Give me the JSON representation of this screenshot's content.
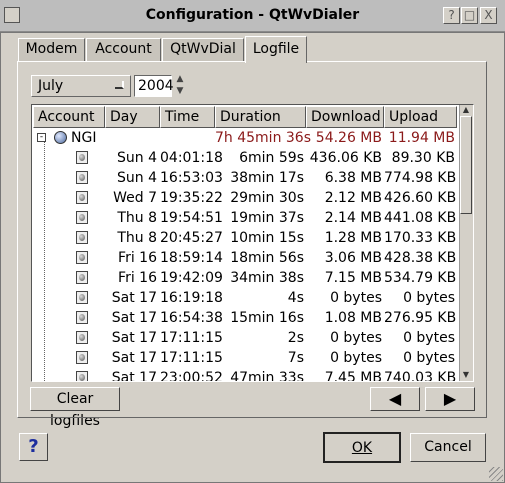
{
  "window": {
    "title": "Configuration - QtWvDialer",
    "title_buttons": [
      "?",
      "□",
      "X"
    ]
  },
  "tabs": [
    {
      "label": "Modem"
    },
    {
      "label": "Account"
    },
    {
      "label": "QtWvDial"
    },
    {
      "label": "Logfile",
      "active": true
    }
  ],
  "filter": {
    "month": "July",
    "year": "2004"
  },
  "table": {
    "columns": [
      "Account",
      "Day",
      "Time",
      "Duration",
      "Download",
      "Upload"
    ],
    "group": {
      "name": "NGI",
      "duration": "7h 45min 36s",
      "download": "54.26 MB",
      "upload": "11.94 MB"
    },
    "rows": [
      {
        "day": "Sun 4",
        "time": "04:01:18",
        "duration": "6min 59s",
        "download": "436.06 KB",
        "upload": "89.30 KB"
      },
      {
        "day": "Sun 4",
        "time": "16:53:03",
        "duration": "38min 17s",
        "download": "6.38 MB",
        "upload": "774.98 KB"
      },
      {
        "day": "Wed 7",
        "time": "19:35:22",
        "duration": "29min 30s",
        "download": "2.12 MB",
        "upload": "426.60 KB"
      },
      {
        "day": "Thu 8",
        "time": "19:54:51",
        "duration": "19min 37s",
        "download": "2.14 MB",
        "upload": "441.08 KB"
      },
      {
        "day": "Thu 8",
        "time": "20:45:27",
        "duration": "10min 15s",
        "download": "1.28 MB",
        "upload": "170.33 KB"
      },
      {
        "day": "Fri 16",
        "time": "18:59:14",
        "duration": "18min 56s",
        "download": "3.06 MB",
        "upload": "428.38 KB"
      },
      {
        "day": "Fri 16",
        "time": "19:42:09",
        "duration": "34min 38s",
        "download": "7.15 MB",
        "upload": "534.79 KB"
      },
      {
        "day": "Sat 17",
        "time": "16:19:18",
        "duration": "4s",
        "download": "0 bytes",
        "upload": "0 bytes"
      },
      {
        "day": "Sat 17",
        "time": "16:54:38",
        "duration": "15min 16s",
        "download": "1.08 MB",
        "upload": "276.95 KB"
      },
      {
        "day": "Sat 17",
        "time": "17:11:15",
        "duration": "2s",
        "download": "0 bytes",
        "upload": "0 bytes"
      },
      {
        "day": "Sat 17",
        "time": "17:11:15",
        "duration": "7s",
        "download": "0 bytes",
        "upload": "0 bytes"
      },
      {
        "day": "Sat 17",
        "time": "23:00:52",
        "duration": "47min 33s",
        "download": "7.45 MB",
        "upload": "740.03 KB"
      }
    ]
  },
  "buttons": {
    "clear_logfiles": "Clear logfiles",
    "prev": "◀",
    "next": "▶",
    "help": "?",
    "ok": "OK",
    "cancel": "Cancel"
  },
  "icons": {
    "scroll_up": "▲",
    "scroll_down": "▼",
    "spin_up": "▲",
    "spin_down": "▼"
  },
  "colors": {
    "summary_text": "#8b1a1a",
    "help_icon": "#1c2d9e"
  }
}
